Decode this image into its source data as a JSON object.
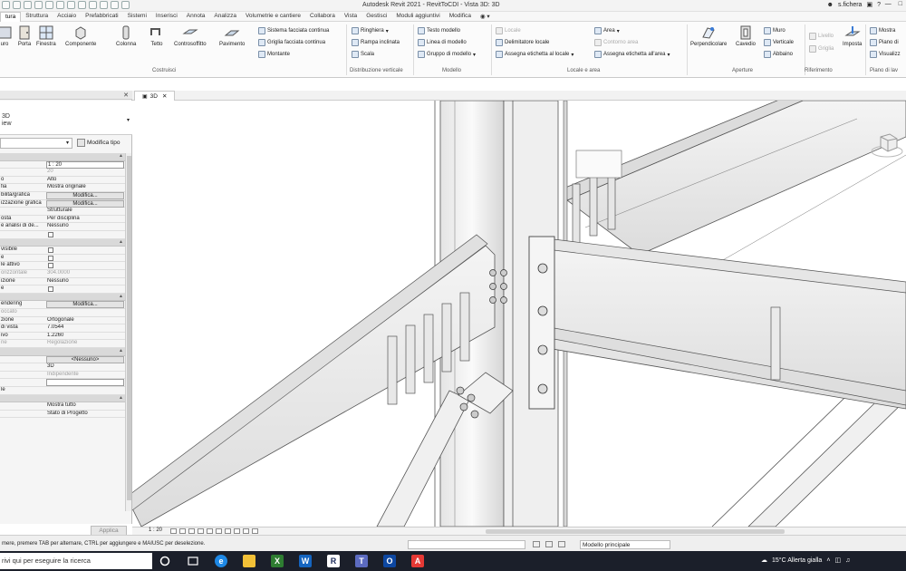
{
  "window": {
    "title": "Autodesk Revit 2021 - RevitToCDI - Vista 3D: 3D",
    "user": "s.fichera"
  },
  "ribbon_tabs": [
    "tura",
    "Struttura",
    "Acciaio",
    "Prefabbricati",
    "Sistemi",
    "Inserisci",
    "Annota",
    "Analizza",
    "Volumetrie e cantiere",
    "Collabora",
    "Vista",
    "Gestisci",
    "Moduli aggiuntivi",
    "Modifica"
  ],
  "ribbon": {
    "costruisci": {
      "label": "Costruisci",
      "buttons": [
        "uro",
        "Porta",
        "Finestra",
        "Componente",
        "Colonna",
        "Tetto",
        "Controsoffitto",
        "Pavimento"
      ],
      "small": [
        "Sistema facciata continua",
        "Griglia facciata continua",
        "Montante"
      ]
    },
    "distribuzione": {
      "label": "Distribuzione verticale",
      "small": [
        "Ringhiera",
        "Rampa inclinata",
        "Scala"
      ]
    },
    "modello": {
      "label": "Modello",
      "small": [
        "Testo modello",
        "Linea di modello",
        "Gruppo di modello"
      ]
    },
    "locale": {
      "label": "Locale e area",
      "small": [
        "Locale",
        "Delimitatore locale",
        "Assegna etichetta al locale",
        "Area",
        "Contorno area",
        "Assegna etichetta all'area"
      ]
    },
    "aperture": {
      "label": "Aperture",
      "buttons": [
        "Perpendicolare",
        "Cavedio"
      ],
      "small": [
        "Muro",
        "Verticale",
        "Abbaino"
      ]
    },
    "riferimento": {
      "label": "Riferimento",
      "small": [
        "Livello",
        "Griglia"
      ],
      "buttons": [
        "Imposta"
      ]
    },
    "piano": {
      "label": "Piano di lav",
      "small": [
        "Mostra",
        "Piano di",
        "Visualizz"
      ]
    }
  },
  "properties": {
    "type_line1": "3D",
    "type_line2": "iew",
    "edit_type": "Modifica tipo",
    "sections": {
      "grafica": "",
      "testo": "",
      "estensioni": "",
      "fotocamera": "",
      "dati": "",
      "fasi": ""
    },
    "rows": [
      {
        "label": "",
        "value": "1 : 20",
        "kind": "input"
      },
      {
        "label": "",
        "value": "20",
        "kind": "gray"
      },
      {
        "label": "o",
        "value": "Alto",
        "kind": "text"
      },
      {
        "label": "fia",
        "value": "Mostra originale",
        "kind": "text"
      },
      {
        "label": "bilità/grafica",
        "value": "Modifica...",
        "kind": "button"
      },
      {
        "label": "izzazione grafica",
        "value": "Modifica...",
        "kind": "button"
      },
      {
        "label": "",
        "value": "Strutturale",
        "kind": "text"
      },
      {
        "label": "osta",
        "value": "Per disciplina",
        "kind": "text"
      },
      {
        "label": "e analisi di de...",
        "value": "Nessuno",
        "kind": "text"
      },
      {
        "label": "",
        "value": "",
        "kind": "checkbox"
      },
      {
        "label": "visibile",
        "value": "",
        "kind": "checkbox"
      },
      {
        "label": "e",
        "value": "",
        "kind": "checkbox"
      },
      {
        "label": "le attivo",
        "value": "",
        "kind": "checkbox"
      },
      {
        "label": "orizzontale",
        "value": "304.0000",
        "kind": "gray"
      },
      {
        "label": "izione",
        "value": "Nessuno",
        "kind": "text"
      },
      {
        "label": "e",
        "value": "",
        "kind": "checkbox"
      },
      {
        "label": "endering",
        "value": "Modifica...",
        "kind": "button"
      },
      {
        "label": "occato",
        "value": "",
        "kind": "gray"
      },
      {
        "label": "zione",
        "value": "Ortogonale",
        "kind": "text"
      },
      {
        "label": "di vista",
        "value": "7.0544",
        "kind": "text"
      },
      {
        "label": "ivo",
        "value": "1.2260",
        "kind": "text"
      },
      {
        "label": "ne",
        "value": "Regolazione",
        "kind": "gray"
      },
      {
        "label": "",
        "value": "<Nessuno>",
        "kind": "button"
      },
      {
        "label": "",
        "value": "3D",
        "kind": "text"
      },
      {
        "label": "",
        "value": "Indipendente",
        "kind": "gray"
      },
      {
        "label": "",
        "value": "",
        "kind": "input"
      },
      {
        "label": "le",
        "value": "",
        "kind": "text"
      },
      {
        "label": "",
        "value": "Mostra tutto",
        "kind": "text"
      },
      {
        "label": "",
        "value": "Stato di Progetto",
        "kind": "text"
      }
    ],
    "apply": "Applica"
  },
  "view_tab": "3D",
  "view_scale": "1 : 20",
  "status": {
    "message": "mere, premere TAB per alternare, CTRL per aggiungere e MAIUSC per deselezione.",
    "workset": "",
    "model": "Modello principale"
  },
  "taskbar": {
    "search": "rivi qui per eseguire la ricerca",
    "weather": "15°C  Allerta gialla"
  }
}
